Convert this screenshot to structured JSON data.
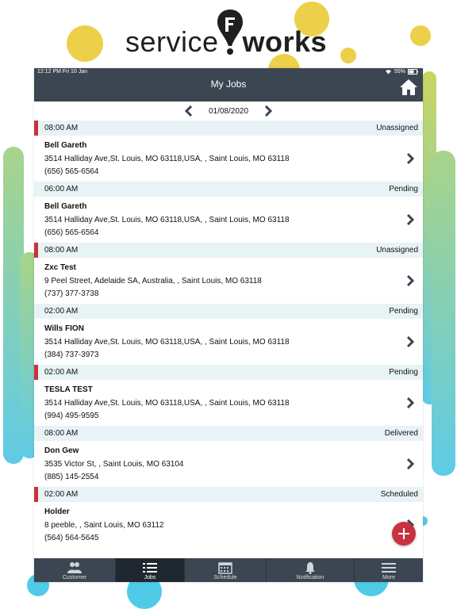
{
  "brand": {
    "left": "service",
    "right": "works"
  },
  "statusbar": {
    "time_date": "12:12 PM  Fri 10 Jan",
    "battery": "55%"
  },
  "header": {
    "title": "My Jobs"
  },
  "date_nav": {
    "date": "01/08/2020"
  },
  "jobs": [
    {
      "time": "08:00 AM",
      "status": "Unassigned",
      "name": "Bell Gareth",
      "address": "3514 Halliday Ave,St. Louis, MO 63118,USA, , Saint Louis, MO 63118",
      "phone": "(656) 565-6564",
      "stripe": "#c8323f"
    },
    {
      "time": "06:00 AM",
      "status": "Pending",
      "name": "Bell Gareth",
      "address": "3514 Halliday Ave,St. Louis, MO 63118,USA, , Saint Louis, MO 63118",
      "phone": "(656) 565-6564",
      "stripe": ""
    },
    {
      "time": "08:00 AM",
      "status": "Unassigned",
      "name": "Zxc Test",
      "address": "9 Peel Street, Adelaide SA, Australia, , Saint Louis, MO 63118",
      "phone": "(737) 377-3738",
      "stripe": "#c8323f"
    },
    {
      "time": "02:00 AM",
      "status": "Pending",
      "name": "Wills FION",
      "address": "3514 Halliday Ave,St. Louis, MO 63118,USA, , Saint Louis, MO 63118",
      "phone": "(384) 737-3973",
      "stripe": ""
    },
    {
      "time": "02:00 AM",
      "status": "Pending",
      "name": "TESLA TEST",
      "address": "3514 Halliday Ave,St. Louis, MO 63118,USA, , Saint Louis, MO 63118",
      "phone": "(994) 495-9595",
      "stripe": "#c8323f"
    },
    {
      "time": "08:00 AM",
      "status": "Delivered",
      "name": "Don Gew",
      "address": "3535 Victor St, , Saint Louis, MO 63104",
      "phone": "(885) 145-2554",
      "stripe": ""
    },
    {
      "time": "02:00 AM",
      "status": "Scheduled",
      "name": "Holder",
      "address": "8 peeble, , Saint Louis, MO 63112",
      "phone": "(564) 564-5645",
      "stripe": "#c8323f"
    }
  ],
  "tabs": [
    {
      "label": "Customer",
      "icon": "people-icon"
    },
    {
      "label": "Jobs",
      "icon": "list-icon"
    },
    {
      "label": "Schedule",
      "icon": "calendar-icon"
    },
    {
      "label": "Notification",
      "icon": "bell-icon"
    },
    {
      "label": "More",
      "icon": "menu-icon"
    }
  ],
  "colors": {
    "bar": "#3b4652",
    "header_row": "#e8f3f6",
    "accent_red": "#c8323f",
    "active_tab": "#1f2830"
  }
}
